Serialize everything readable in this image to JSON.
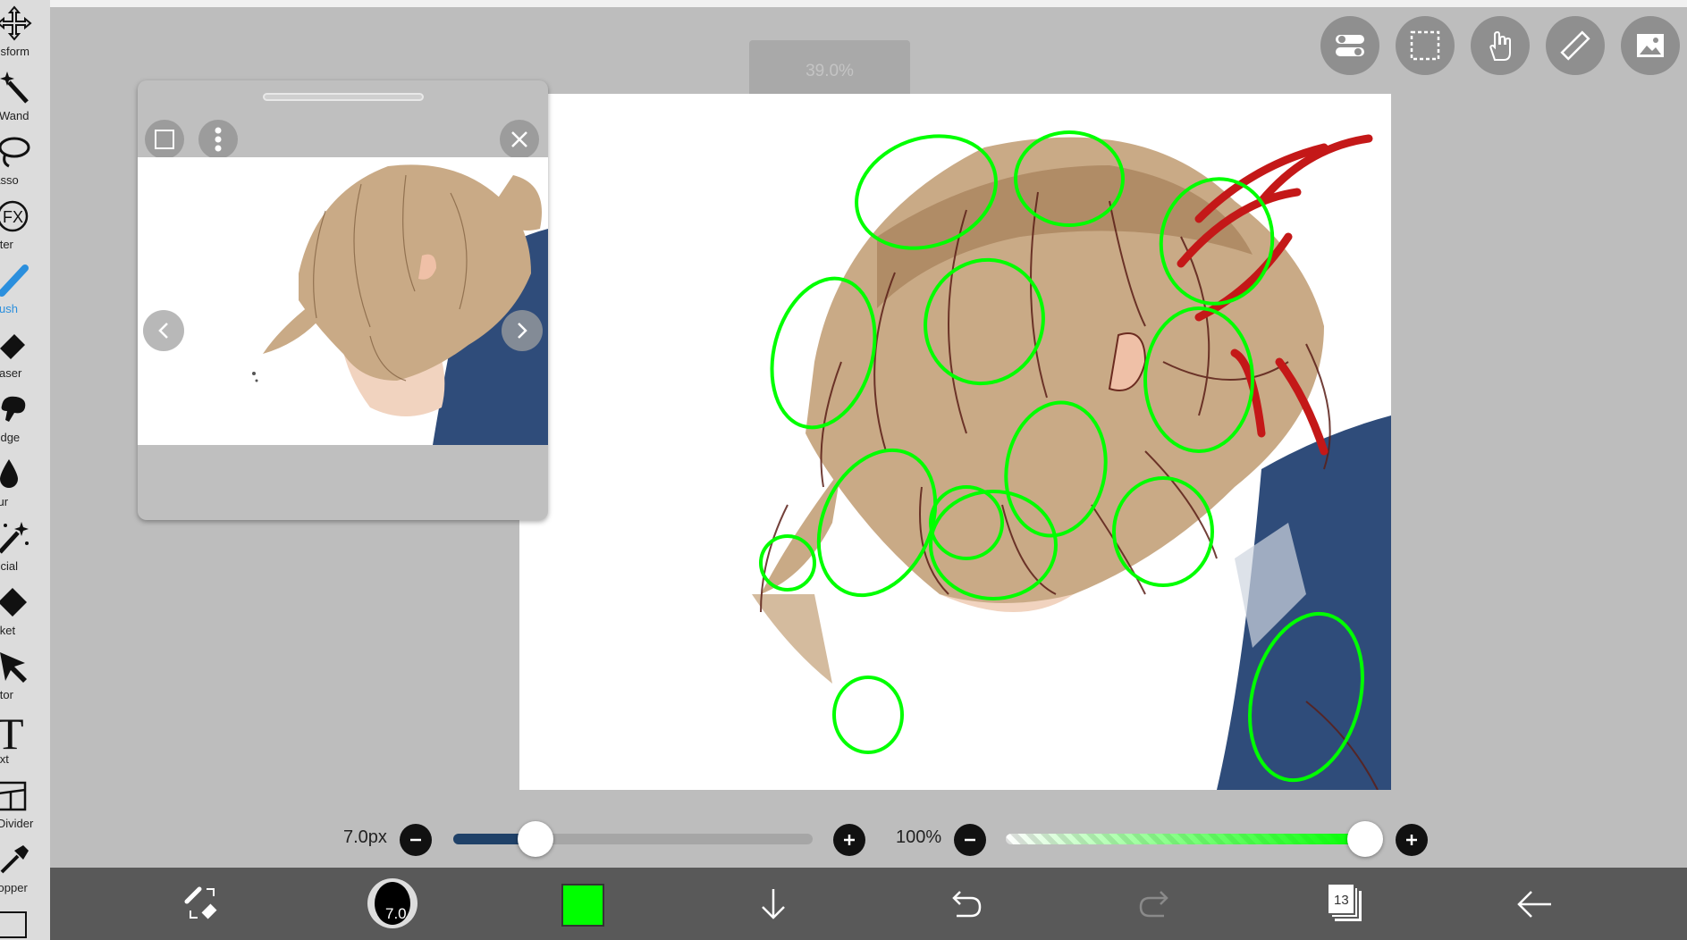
{
  "zoom": {
    "label": "39.0%"
  },
  "tools": [
    {
      "label": "ansform",
      "icon": "move-icon"
    },
    {
      "label": "ic Wand",
      "icon": "magic-wand-icon"
    },
    {
      "label": "Lasso",
      "icon": "lasso-icon"
    },
    {
      "label": "Filter",
      "icon": "fx-icon"
    },
    {
      "label": "Brush",
      "icon": "brush-icon",
      "active": true
    },
    {
      "label": "Eraser",
      "icon": "eraser-icon"
    },
    {
      "label": "nudge",
      "icon": "smudge-icon"
    },
    {
      "label": "Blur",
      "icon": "blur-drop-icon"
    },
    {
      "label": "pecial",
      "icon": "special-wand-icon"
    },
    {
      "label": "ucket",
      "icon": "bucket-icon"
    },
    {
      "label": "ector",
      "icon": "selector-arrow-icon"
    },
    {
      "label": "Text",
      "icon": "text-icon",
      "glyph": "T"
    },
    {
      "label": "e Divider",
      "icon": "frame-divider-icon"
    },
    {
      "label": "dropper",
      "icon": "eyedropper-icon"
    }
  ],
  "top_buttons": [
    "toggle-icon",
    "selection-icon",
    "hand-icon",
    "ruler-icon",
    "image-icon"
  ],
  "brush_size": {
    "label": "7.0px",
    "value": 7.0,
    "fraction": 0.23
  },
  "opacity": {
    "label": "100%",
    "fraction": 1.0
  },
  "bottom_bar": {
    "brush_preview_value": "7.0",
    "current_color": "#00ff00",
    "layers_count": "13"
  },
  "colors": {
    "accent": "#2b8fdd",
    "stroke_green": "#00ff00",
    "stroke_red": "#c41818",
    "slider_fill": "#1f4168"
  }
}
